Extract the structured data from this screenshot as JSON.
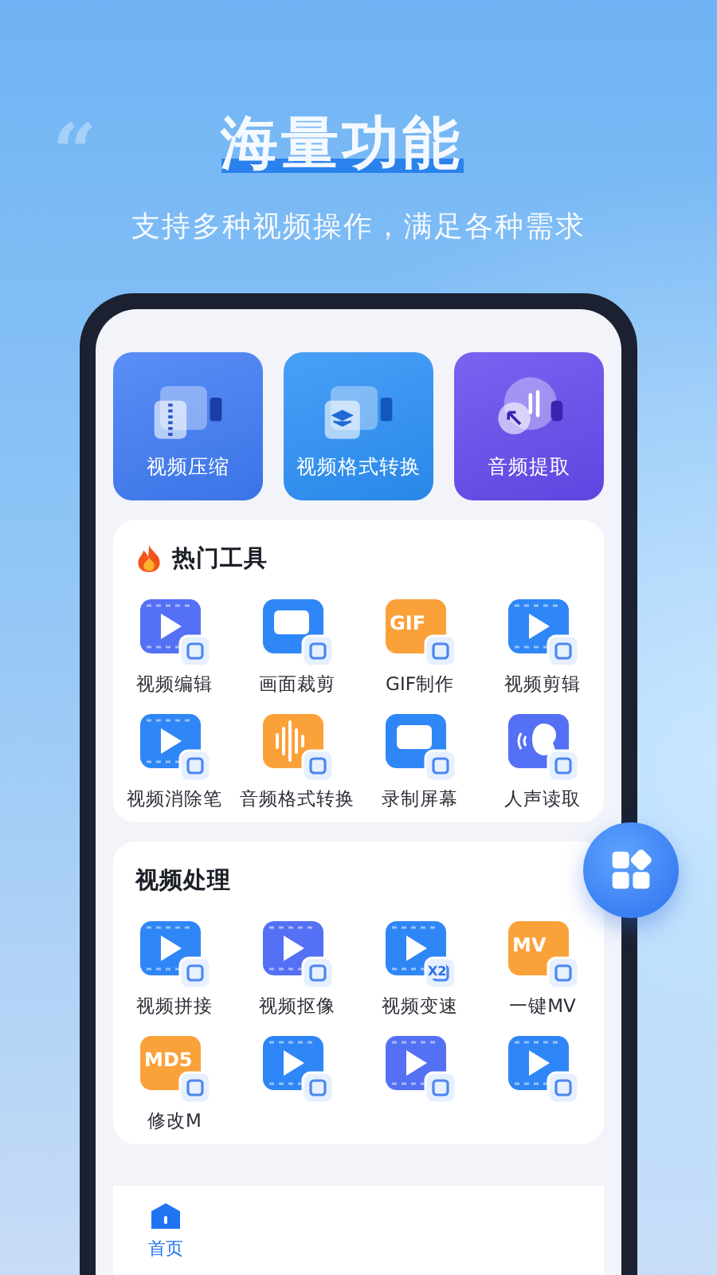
{
  "hero": {
    "quote_mark": "“",
    "title": "海量功能",
    "subtitle": "支持多种视频操作，满足各种需求"
  },
  "feature_cards": [
    {
      "label": "视频压缩",
      "color": "#3f7bf5",
      "kind": "zip"
    },
    {
      "label": "视频格式转换",
      "color": "#2b90f6",
      "kind": "layers"
    },
    {
      "label": "音频提取",
      "color": "#6549ee",
      "kind": "audio"
    }
  ],
  "sections": [
    {
      "title": "热门工具",
      "hot": true,
      "tools": [
        {
          "label": "视频编辑",
          "color": "#5470f4",
          "kind": "play"
        },
        {
          "label": "画面裁剪",
          "color": "#2f86f6",
          "kind": "screen"
        },
        {
          "label": "GIF制作",
          "color": "#fba13a",
          "kind": "letters",
          "tile_text": "GIF"
        },
        {
          "label": "视频剪辑",
          "color": "#2f86f6",
          "kind": "play"
        },
        {
          "label": "视频消除笔",
          "color": "#2f86f6",
          "kind": "play"
        },
        {
          "label": "音频格式转换",
          "color": "#fba13a",
          "kind": "wave"
        },
        {
          "label": "录制屏幕",
          "color": "#2f86f6",
          "kind": "screen"
        },
        {
          "label": "人声读取",
          "color": "#5470f4",
          "kind": "voice"
        }
      ]
    },
    {
      "title": "视频处理",
      "hot": false,
      "tools": [
        {
          "label": "视频拼接",
          "color": "#2f86f6",
          "kind": "play"
        },
        {
          "label": "视频抠像",
          "color": "#5470f4",
          "kind": "play"
        },
        {
          "label": "视频变速",
          "color": "#2f86f6",
          "kind": "play",
          "badge_text": "X2"
        },
        {
          "label": "一键MV",
          "color": "#fba13a",
          "kind": "letters",
          "tile_text": "MV"
        },
        {
          "label": "修改M",
          "color": "#fba13a",
          "kind": "letters",
          "tile_text": "MD5"
        },
        {
          "color": "#2f86f6",
          "kind": "play"
        },
        {
          "color": "#5470f4",
          "kind": "play"
        },
        {
          "color": "#2f86f6",
          "kind": "play"
        }
      ]
    }
  ],
  "bottom_nav": [
    {
      "label": "首页",
      "selected": true
    }
  ]
}
